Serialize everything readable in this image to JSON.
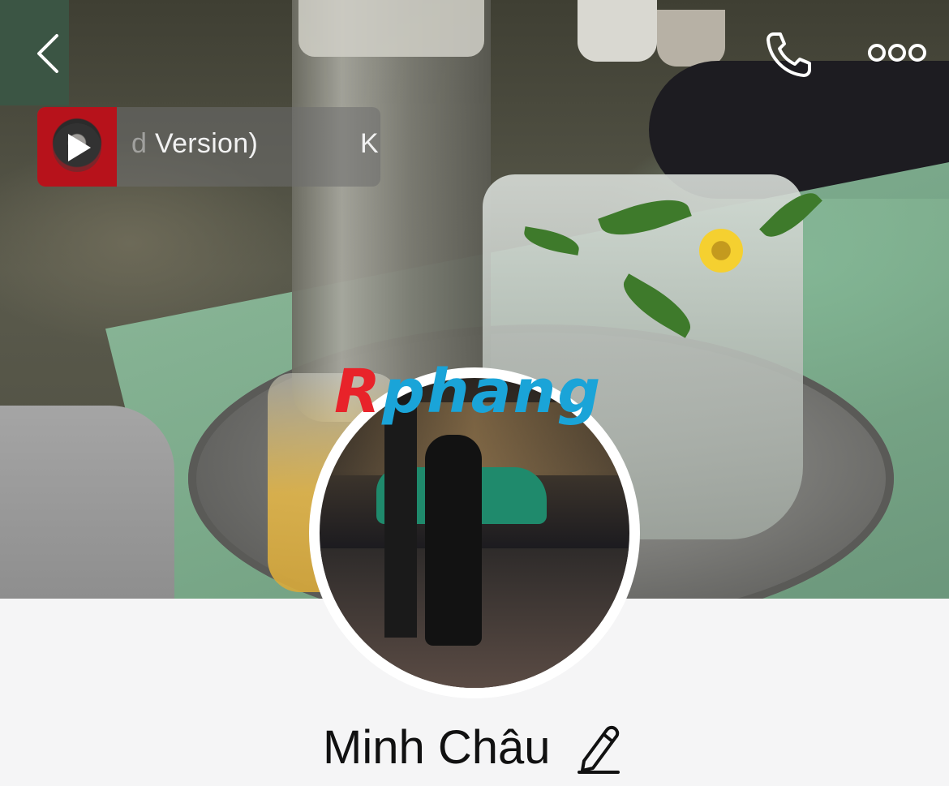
{
  "header": {
    "back_icon": "chevron-left-icon",
    "call_icon": "phone-icon",
    "more_icon": "more-horizontal-icon"
  },
  "music": {
    "title_faded": "d",
    "title": " Version)",
    "artist": "K",
    "play_icon": "play-icon"
  },
  "watermark": {
    "first": "R",
    "rest": "phang"
  },
  "profile": {
    "name": "Minh Châu",
    "edit_icon": "pencil-icon"
  },
  "colors": {
    "background": "#f5f5f6",
    "name_text": "#111111",
    "watermark_red": "#e8232a",
    "watermark_blue": "#1aa4d8"
  }
}
